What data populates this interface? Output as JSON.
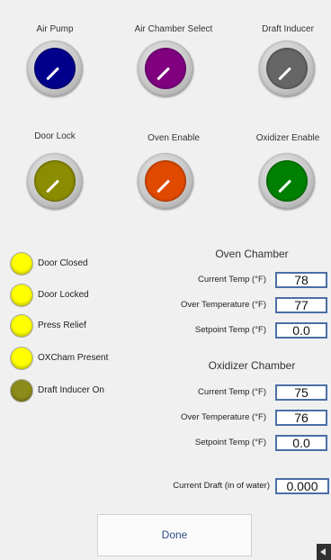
{
  "knobs": [
    {
      "label": "Air Pump",
      "color": "#00008c"
    },
    {
      "label": "Air Chamber Select",
      "color": "#800080"
    },
    {
      "label": "Draft Inducer",
      "color": "#666666"
    },
    {
      "label": "Door Lock",
      "color": "#8c8c00"
    },
    {
      "label": "Oven Enable",
      "color": "#e04a00"
    },
    {
      "label": "Oxidizer Enable",
      "color": "#008000"
    }
  ],
  "leds": [
    {
      "label": "Door Closed",
      "color": "#ffff00"
    },
    {
      "label": "Door Locked",
      "color": "#ffff00"
    },
    {
      "label": "Press Relief",
      "color": "#ffff00"
    },
    {
      "label": "OXCham Present",
      "color": "#ffff00"
    },
    {
      "label": "Draft Inducer On",
      "color": "#8c8c1a"
    }
  ],
  "oven": {
    "title": "Oven Chamber",
    "current_label": "Current Temp (°F)",
    "current_value": "78",
    "over_label": "Over Temperature (°F)",
    "over_value": "77",
    "setpoint_label": "Setpoint Temp (°F)",
    "setpoint_value": "0.0"
  },
  "oxidizer": {
    "title": "Oxidizer Chamber",
    "current_label": "Current Temp (°F)",
    "current_value": "75",
    "over_label": "Over Temperature (°F)",
    "over_value": "76",
    "setpoint_label": "Setpoint Temp (°F)",
    "setpoint_value": "0.0"
  },
  "draft": {
    "label": "Current Draft (in of water)",
    "value": "0.000"
  },
  "done_label": "Done",
  "corner_icon": "back-arrow-icon"
}
